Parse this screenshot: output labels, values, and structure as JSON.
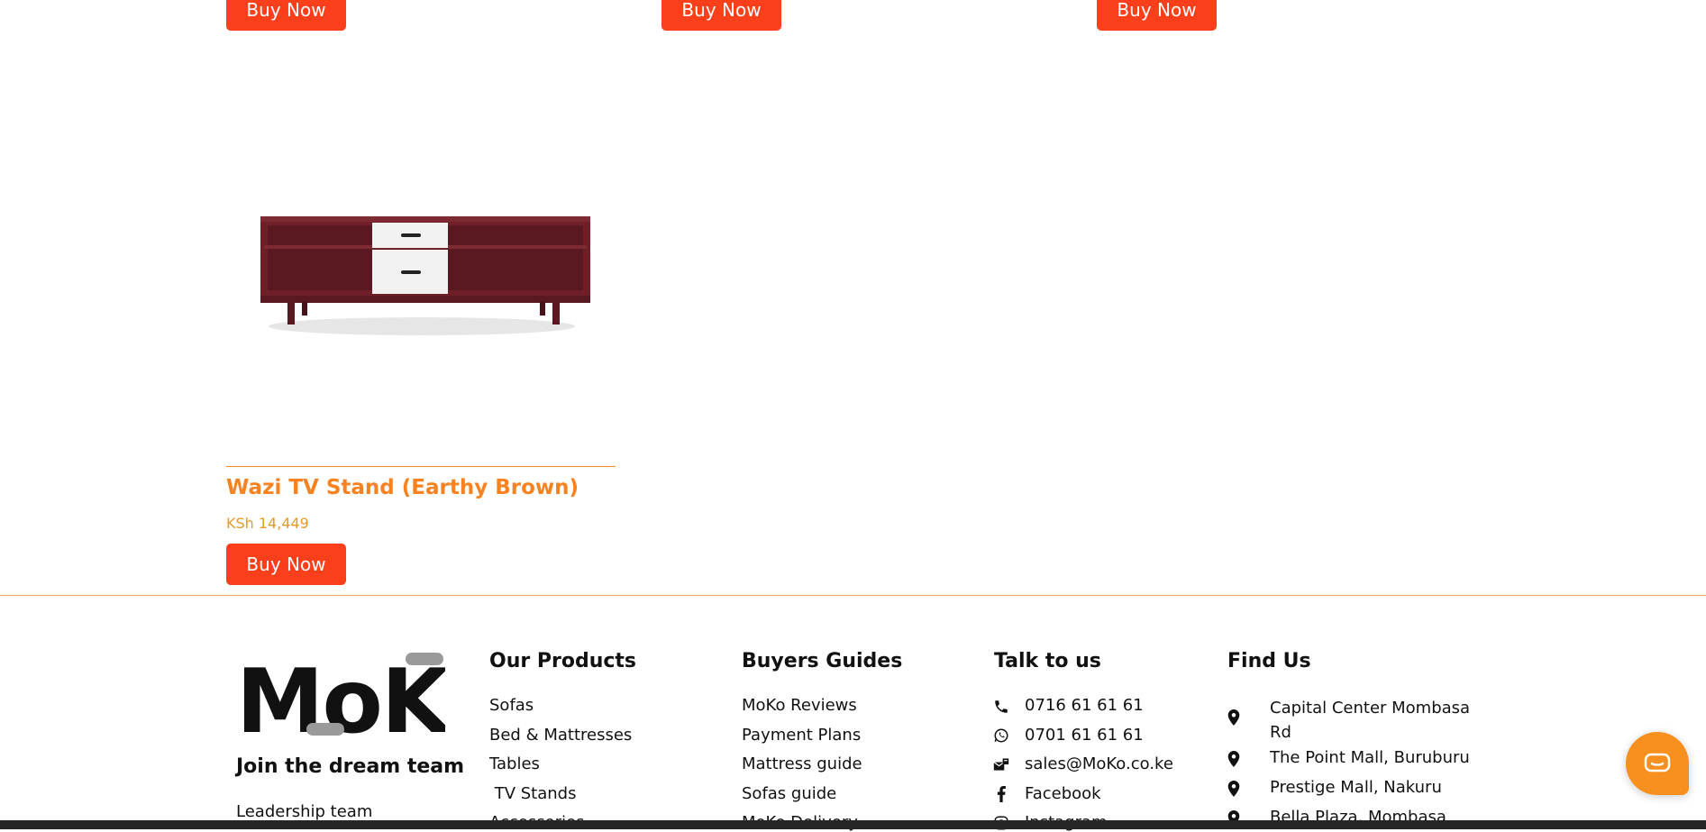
{
  "top_products": {
    "buttons": [
      "Buy Now",
      "Buy Now",
      "Buy Now"
    ]
  },
  "product": {
    "title": "Wazi TV Stand (Earthy Brown)",
    "price": "KSh 14,449",
    "buy_label": "Buy Now"
  },
  "footer": {
    "brand": {
      "logo_text": "MoKo",
      "join_label": "Join the dream team",
      "links": [
        "Leadership team"
      ]
    },
    "products": {
      "heading": "Our Products",
      "links": [
        "Sofas",
        "Bed & Mattresses",
        "Tables",
        " TV Stands",
        "Accessories"
      ]
    },
    "guides": {
      "heading": "Buyers Guides",
      "links": [
        "MoKo Reviews",
        "Payment Plans",
        "Mattress guide",
        "Sofas guide",
        "MoKo Delivery"
      ]
    },
    "talk": {
      "heading": "Talk to us",
      "items": [
        {
          "icon": "phone-icon",
          "label": "0716 61 61 61"
        },
        {
          "icon": "whatsapp-icon",
          "label": "0701 61 61 61"
        },
        {
          "icon": "email-icon",
          "label": "sales@MoKo.co.ke"
        },
        {
          "icon": "facebook-icon",
          "label": "Facebook"
        },
        {
          "icon": "instagram-icon",
          "label": "Instagram"
        }
      ]
    },
    "find": {
      "heading": "Find Us",
      "locations": [
        "Capital Center Mombasa Rd",
        "The Point Mall, Buruburu",
        "Prestige Mall, Nakuru",
        "Bella Plaza, Mombasa"
      ]
    }
  },
  "colors": {
    "accent": "#fb3f1b",
    "title_orange": "#f7821f",
    "chat": "#f7901e"
  }
}
